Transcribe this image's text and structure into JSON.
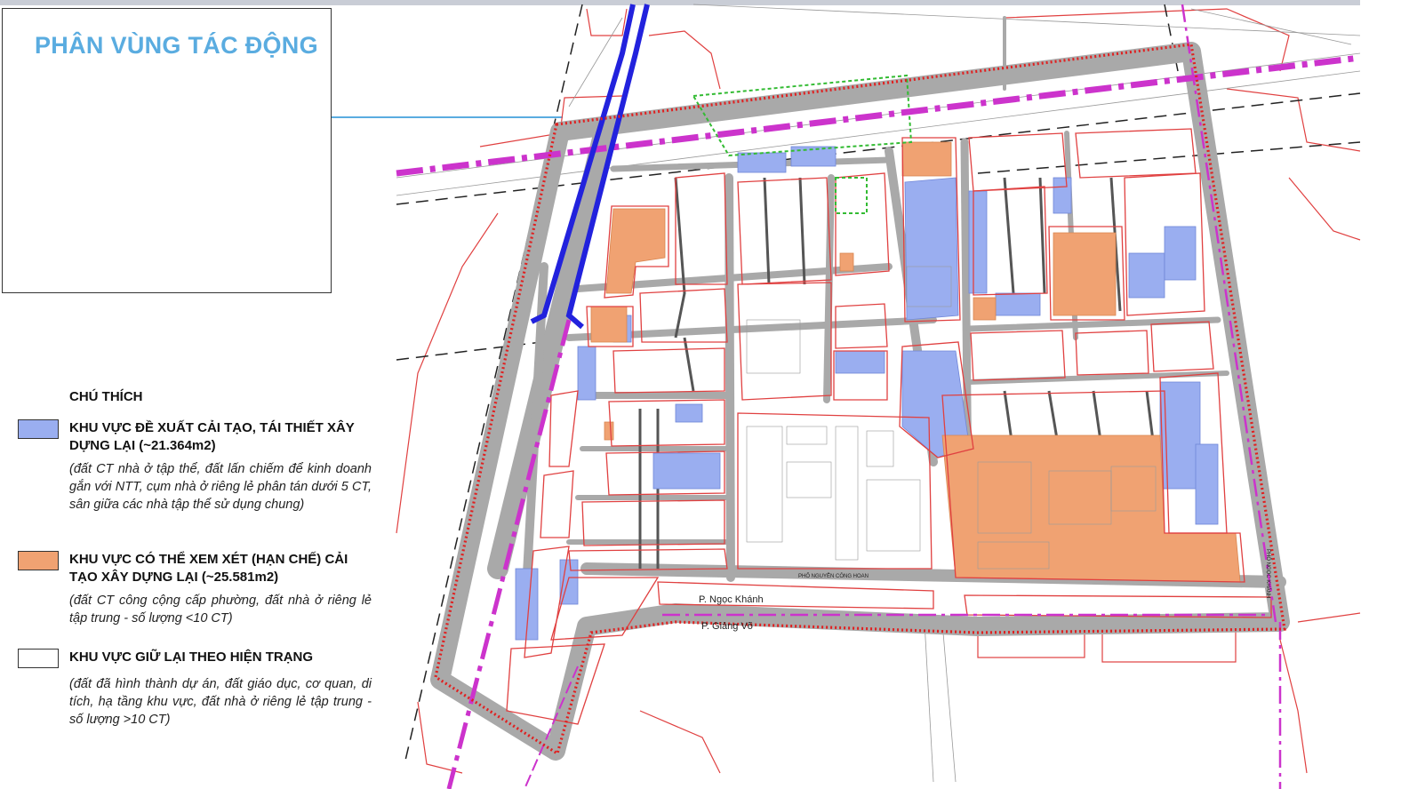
{
  "title": "PHÂN VÙNG TÁC ĐỘNG",
  "legend": {
    "heading": "CHÚ THÍCH",
    "items": [
      {
        "color": "#9aaef0",
        "label": "KHU VỰC ĐỀ XUẤT CẢI TẠO, TÁI THIẾT XÂY DỰNG LẠI (~21.364m2)",
        "description": "(đất CT nhà ở tập thể, đất lấn chiếm để kinh doanh gắn với NTT, cụm nhà ở riêng lẻ phân tán dưới 5 CT, sân giữa các nhà tập thể sử dụng chung)"
      },
      {
        "color": "#f0a272",
        "label": "KHU VỰC CÓ THỂ XEM XÉT (HẠN CHẾ) CẢI TẠO XÂY DỰNG LẠI (~25.581m2)",
        "description": "(đất CT công cộng cấp phường, đất nhà ở riêng lẻ tập trung - số lượng <10 CT)"
      },
      {
        "color": "#ffffff",
        "label": "KHU VỰC GIỮ LẠI THEO HIỆN TRẠNG",
        "description": "(đất đã hình thành dự án, đất giáo dục, cơ quan, di tích, hạ tầng khu vực, đất nhà ở riêng lẻ tập trung - số lượng >10 CT)"
      }
    ]
  },
  "map": {
    "street_labels": {
      "ngoc_khanh": "P. Ngọc Khánh",
      "giang_vo": "P. Giảng Võ",
      "nguyen_cong_hoan": "PHỐ NGUYỄN CÔNG HOAN",
      "doc_ngoc_khanh": "PHỐ NGỌC KHÁNH"
    },
    "colors": {
      "road": "#a9a9a9",
      "boundary": "#e02020",
      "parcel": "#e04040",
      "transit": "#2222dd",
      "axis": "#cc33cc",
      "green_outline": "#33bb33"
    }
  }
}
